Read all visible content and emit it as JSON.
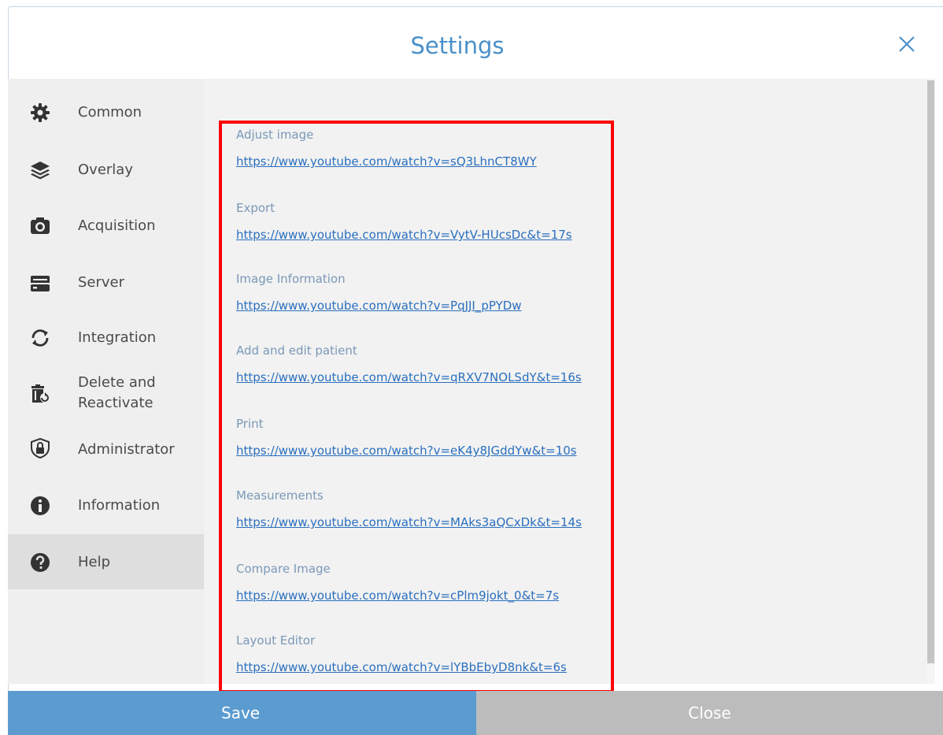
{
  "dialog": {
    "title": "Settings",
    "close_icon": "close-icon"
  },
  "sidebar": {
    "items": [
      {
        "label": "Common",
        "icon": "gear-icon"
      },
      {
        "label": "Overlay",
        "icon": "layers-icon"
      },
      {
        "label": "Acquisition",
        "icon": "camera-icon"
      },
      {
        "label": "Server",
        "icon": "server-icon"
      },
      {
        "label": "Integration",
        "icon": "sync-icon"
      },
      {
        "label": "Delete and Reactivate",
        "label_line1": "Delete and",
        "label_line2": "Reactivate",
        "icon": "trash-restore-icon"
      },
      {
        "label": "Administrator",
        "icon": "shield-lock-icon"
      },
      {
        "label": "Information",
        "icon": "info-icon"
      },
      {
        "label": "Help",
        "icon": "help-icon",
        "active": true
      }
    ]
  },
  "help": {
    "entries": [
      {
        "title": "Adjust image",
        "url": "https://www.youtube.com/watch?v=sQ3LhnCT8WY"
      },
      {
        "title": "Export",
        "url": "https://www.youtube.com/watch?v=VytV-HUcsDc&t=17s"
      },
      {
        "title": "Image Information",
        "url": "https://www.youtube.com/watch?v=PqJJI_pPYDw"
      },
      {
        "title": "Add and edit patient",
        "url": "https://www.youtube.com/watch?v=qRXV7NOLSdY&t=16s"
      },
      {
        "title": "Print",
        "url": "https://www.youtube.com/watch?v=eK4y8JGddYw&t=10s"
      },
      {
        "title": "Measurements",
        "url": "https://www.youtube.com/watch?v=MAks3aQCxDk&t=14s"
      },
      {
        "title": "Compare Image",
        "url": "https://www.youtube.com/watch?v=cPlm9jokt_0&t=7s"
      },
      {
        "title": "Layout Editor",
        "url": "https://www.youtube.com/watch?v=lYBbEbyD8nk&t=6s"
      }
    ]
  },
  "footer": {
    "save_label": "Save",
    "close_label": "Close"
  },
  "colors": {
    "accent": "#4a90c9",
    "save_button": "#5b9bd0",
    "close_button": "#bcbcbc",
    "link": "#2a6fbe",
    "highlight": "#ff0000"
  }
}
